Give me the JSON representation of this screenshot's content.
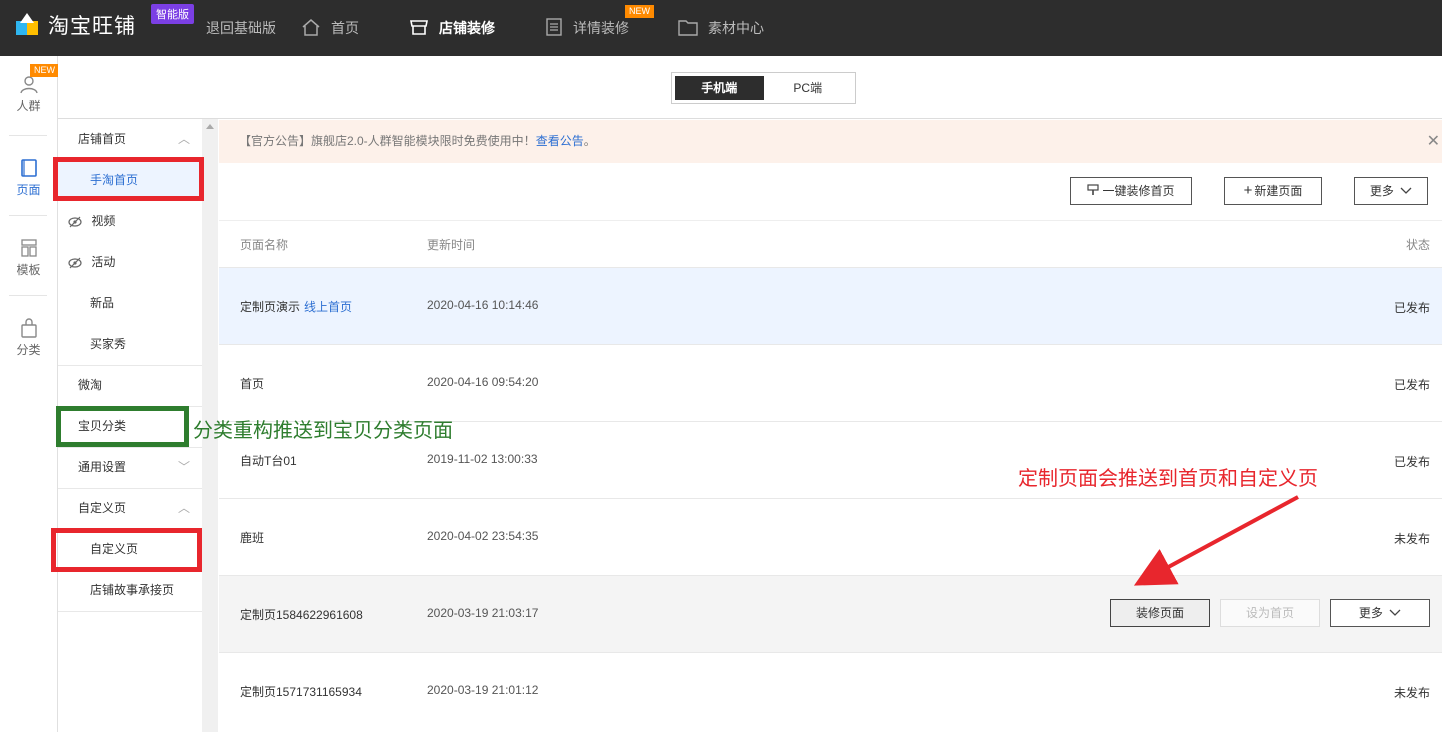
{
  "topbar": {
    "logo_text": "淘宝旺铺",
    "edition_badge": "智能版",
    "back_link": "退回基础版",
    "nav": [
      {
        "label": "首页",
        "icon": "home-icon"
      },
      {
        "label": "店铺装修",
        "icon": "store-icon",
        "active": true
      },
      {
        "label": "详情装修",
        "icon": "document-icon",
        "badge": "NEW"
      },
      {
        "label": "素材中心",
        "icon": "folder-icon"
      }
    ]
  },
  "rail": {
    "items": [
      {
        "label": "人群",
        "icon": "user-icon",
        "badge": "NEW"
      },
      {
        "label": "页面",
        "icon": "page-icon",
        "active": true
      },
      {
        "label": "模板",
        "icon": "template-icon"
      },
      {
        "label": "分类",
        "icon": "bag-icon"
      }
    ]
  },
  "device_toggle": {
    "mobile": "手机端",
    "pc": "PC端",
    "selected": "mobile"
  },
  "subnav": {
    "store_home": "店铺首页",
    "mobile_home": "手淘首页",
    "video": "视频",
    "activity": "活动",
    "new": "新品",
    "buyer_show": "买家秀",
    "weitao": "微淘",
    "category": "宝贝分类",
    "settings": "通用设置",
    "custom_page_group": "自定义页",
    "custom_page": "自定义页",
    "story_page": "店铺故事承接页"
  },
  "notice": {
    "prefix": "【官方公告】旗舰店2.0-人群智能模块限时免费使用中！",
    "link": "查看公告",
    "suffix": "。",
    "close": "✕"
  },
  "toolbar": {
    "one_click": "一键装修首页",
    "new_page": "新建页面",
    "more": "更多"
  },
  "table": {
    "headers": {
      "name": "页面名称",
      "time": "更新时间",
      "status": "状态"
    },
    "rows": [
      {
        "name": "定制页演示",
        "tag": "线上首页",
        "time": "2020-04-16 10:14:46",
        "status": "已发布"
      },
      {
        "name": "首页",
        "time": "2020-04-16 09:54:20",
        "status": "已发布"
      },
      {
        "name": "自动T台01",
        "time": "2019-11-02 13:00:33",
        "status": "已发布"
      },
      {
        "name": "鹿班",
        "time": "2020-04-02 23:54:35",
        "status": "未发布"
      },
      {
        "name": "定制页1584622961608",
        "time": "2020-03-19 21:03:17",
        "status": ""
      },
      {
        "name": "定制页1571731165934",
        "time": "2020-03-19 21:01:12",
        "status": "未发布"
      }
    ],
    "row_actions": {
      "edit": "装修页面",
      "set_home": "设为首页",
      "more": "更多"
    }
  },
  "annotations": {
    "green": "分类重构推送到宝贝分类页面",
    "red": "定制页面会推送到首页和自定义页"
  },
  "colors": {
    "accent": "#2d6fd2",
    "topbar": "#2d2d2d",
    "highlight_red": "#e8262d",
    "highlight_green": "#2e7d2e",
    "notice_bg": "#fdf1ea"
  }
}
